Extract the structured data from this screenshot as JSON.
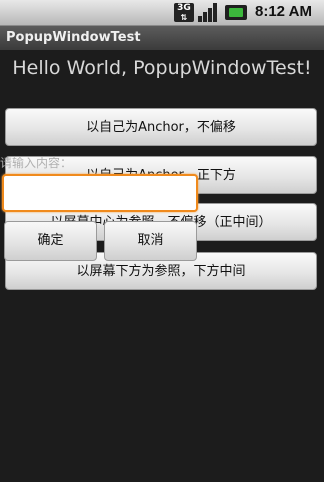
{
  "status_bar": {
    "network_label": "3G",
    "time": "8:12 AM"
  },
  "app": {
    "title": "PopupWindowTest"
  },
  "main": {
    "hello_text": "Hello World, PopupWindowTest!",
    "buttons": [
      {
        "label": "以自己为Anchor，不偏移"
      },
      {
        "label": "以自己为Anchor，正下方"
      },
      {
        "label": "以屏幕中心为参照，不偏移（正中间）"
      },
      {
        "label": "以屏幕下方为参照，下方中间"
      }
    ]
  },
  "popup": {
    "label": "请输入内容：",
    "input_value": "",
    "confirm_label": "确定",
    "cancel_label": "取消"
  },
  "colors": {
    "popup_focus": "#f08a1c",
    "battery": "#3cb83c"
  }
}
